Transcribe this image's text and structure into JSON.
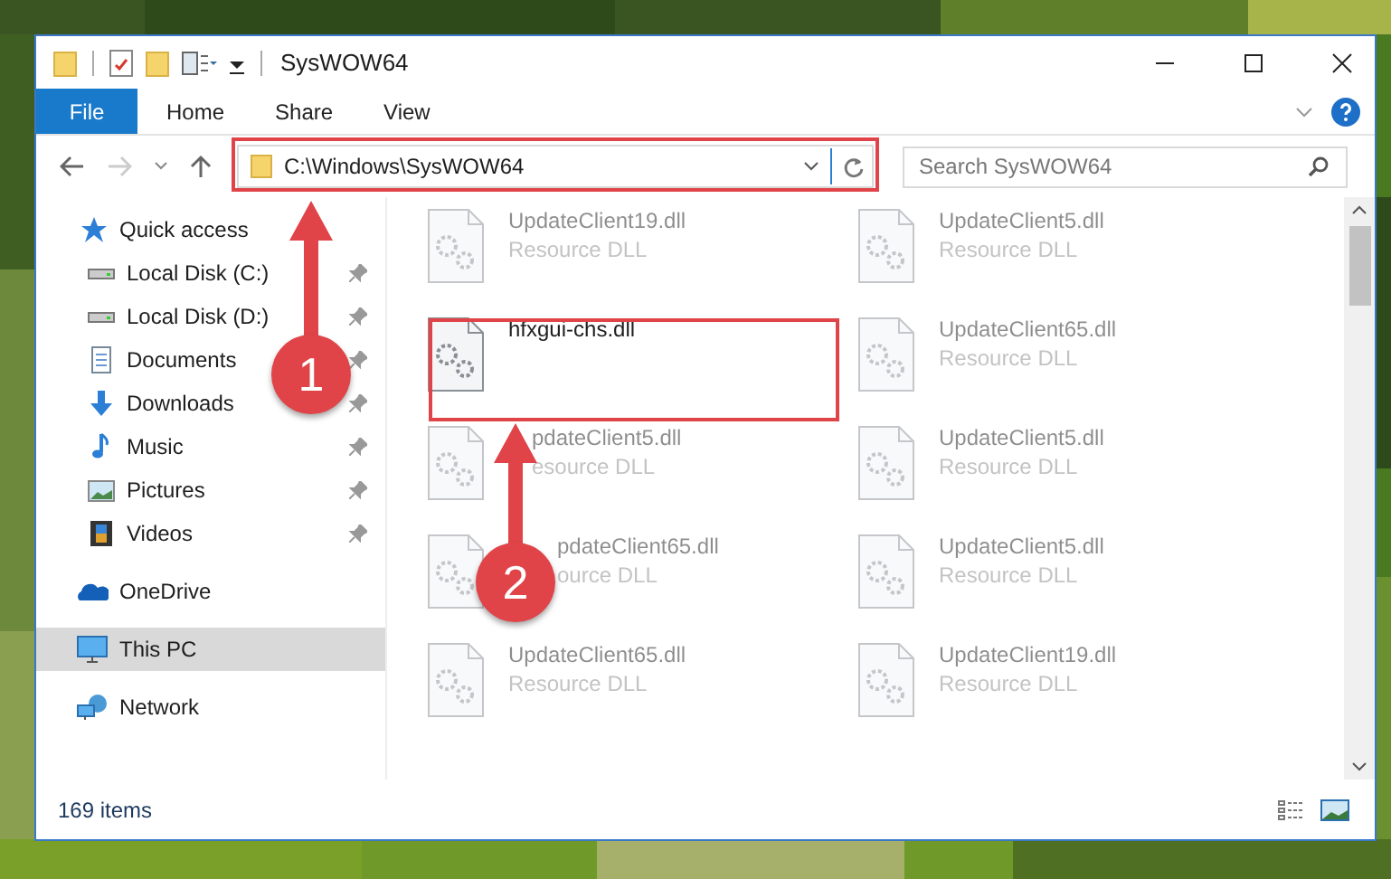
{
  "window": {
    "title": "SysWOW64"
  },
  "ribbon_tabs": [
    {
      "label": "File",
      "kind": "menu"
    },
    {
      "label": "Home",
      "kind": "tab"
    },
    {
      "label": "Share",
      "kind": "tab"
    },
    {
      "label": "View",
      "kind": "tab"
    }
  ],
  "address_bar": {
    "path": "C:\\Windows\\SysWOW64"
  },
  "search": {
    "placeholder": "Search SysWOW64"
  },
  "sidebar": {
    "items": [
      {
        "label": "Quick access",
        "kind": "star",
        "selected": false,
        "children": [
          {
            "label": "Local Disk (C:)",
            "kind": "drive",
            "pinned": true
          },
          {
            "label": "Local Disk (D:)",
            "kind": "drive",
            "pinned": true
          },
          {
            "label": "Documents",
            "kind": "documents",
            "pinned": true
          },
          {
            "label": "Downloads",
            "kind": "downloads",
            "pinned": true
          },
          {
            "label": "Music",
            "kind": "music",
            "pinned": true
          },
          {
            "label": "Pictures",
            "kind": "pictures",
            "pinned": true
          },
          {
            "label": "Videos",
            "kind": "videos",
            "pinned": true
          }
        ]
      },
      {
        "label": "OneDrive",
        "kind": "cloud",
        "selected": false
      },
      {
        "label": "This PC",
        "kind": "computer",
        "selected": true
      },
      {
        "label": "Network",
        "kind": "network",
        "selected": false
      }
    ]
  },
  "files": [
    {
      "name": "UpdateClient19.dll",
      "type": "Resource DLL",
      "selected": false
    },
    {
      "name": "UpdateClient5.dll",
      "type": "Resource DLL",
      "selected": false
    },
    {
      "name": "hfxgui-chs.dll",
      "selected": true
    },
    {
      "name": "UpdateClient65.dll",
      "type": "Resource DLL",
      "selected": false
    },
    {
      "name": "pdateClient5.dll",
      "type": "esource DLL",
      "selected": false
    },
    {
      "name": "UpdateClient5.dll",
      "type": "Resource DLL",
      "selected": false
    },
    {
      "name": "pdateClient65.dll",
      "type": "ource DLL",
      "selected": false
    },
    {
      "name": "UpdateClient5.dll",
      "type": "Resource DLL",
      "selected": false
    },
    {
      "name": "UpdateClient65.dll",
      "type": "Resource DLL",
      "selected": false
    },
    {
      "name": "UpdateClient19.dll",
      "type": "Resource DLL",
      "selected": false
    }
  ],
  "status_bar": {
    "item_count": "169 items"
  },
  "callouts": [
    {
      "number": "1"
    },
    {
      "number": "2"
    }
  ]
}
